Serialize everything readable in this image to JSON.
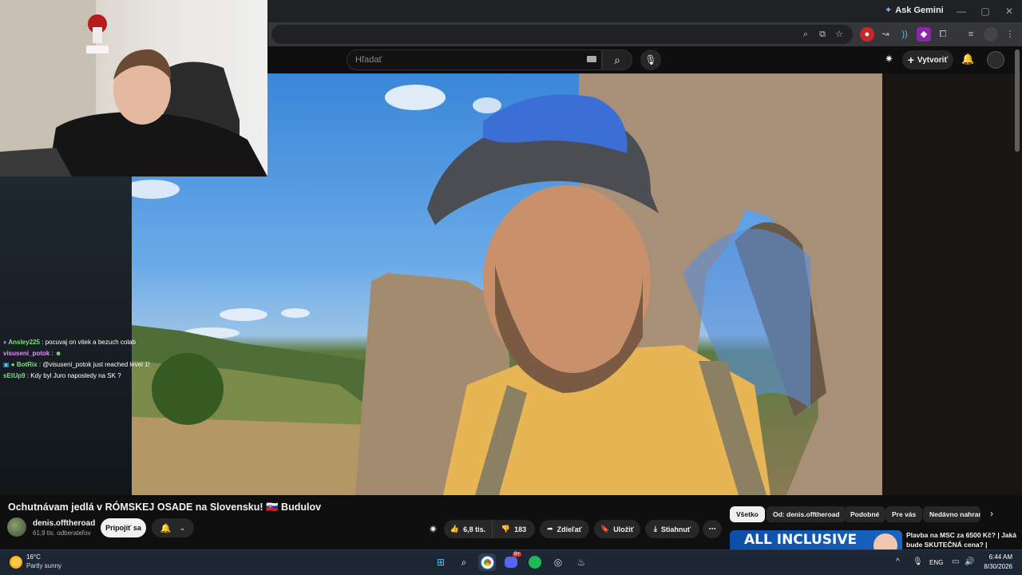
{
  "browser": {
    "ask_gemini": "Ask Gemini",
    "window_controls": [
      "—",
      "▢",
      "✕"
    ]
  },
  "youtube": {
    "search": {
      "placeholder": "Hľadať"
    },
    "create_label": "Vytvoriť"
  },
  "chat": [
    {
      "user": "Ansley225",
      "text": "pocuvaj on vitek a bezuch colab",
      "color": "#7ee07e"
    },
    {
      "user": "visuseni_potok",
      "text": "",
      "color": "#e58cff"
    },
    {
      "user": "BotRix",
      "text": "@visuseni_potok just reached level 1!",
      "color": "#7ee07e"
    },
    {
      "user": "sEtUp9",
      "text": "Kdy byl Juro naposledy na SK ?",
      "color": "#7ee07e"
    }
  ],
  "video": {
    "title": "Ochutnávam jedlá v RÓMSKEJ OSADE na Slovensku! 🇸🇰 Budulov",
    "channel_name": "denis.offtheroad",
    "subscribers": "61,9 tis. odberateľov",
    "join_label": "Pripojiť sa",
    "likes": "6,8 tis.",
    "dislikes": "183",
    "share_label": "Zdieľať",
    "save_label": "Uložiť",
    "download_label": "Stiahnuť",
    "more_label": "⋯"
  },
  "chips": [
    "Všetko",
    "Od: denis.offtheroad",
    "Podobné",
    "Pre vás",
    "Nedávno nahrané"
  ],
  "recommendation": {
    "thumb_text": "ALL INCLUSIVE",
    "title": "Plavba na MSC za 6500 Kč? | Jaká bude SKUTEČNÁ cena? |"
  },
  "taskbar": {
    "temperature": "16°C",
    "weather": "Partly sunny",
    "language": "ENG",
    "time": "6:44 AM",
    "date": "8/30/2026",
    "discord_badge": "9+"
  },
  "colors": {
    "brand_red": "#ff0033",
    "chip_active_bg": "#f1f1f1",
    "taskbar_bg": "#1c2733"
  }
}
